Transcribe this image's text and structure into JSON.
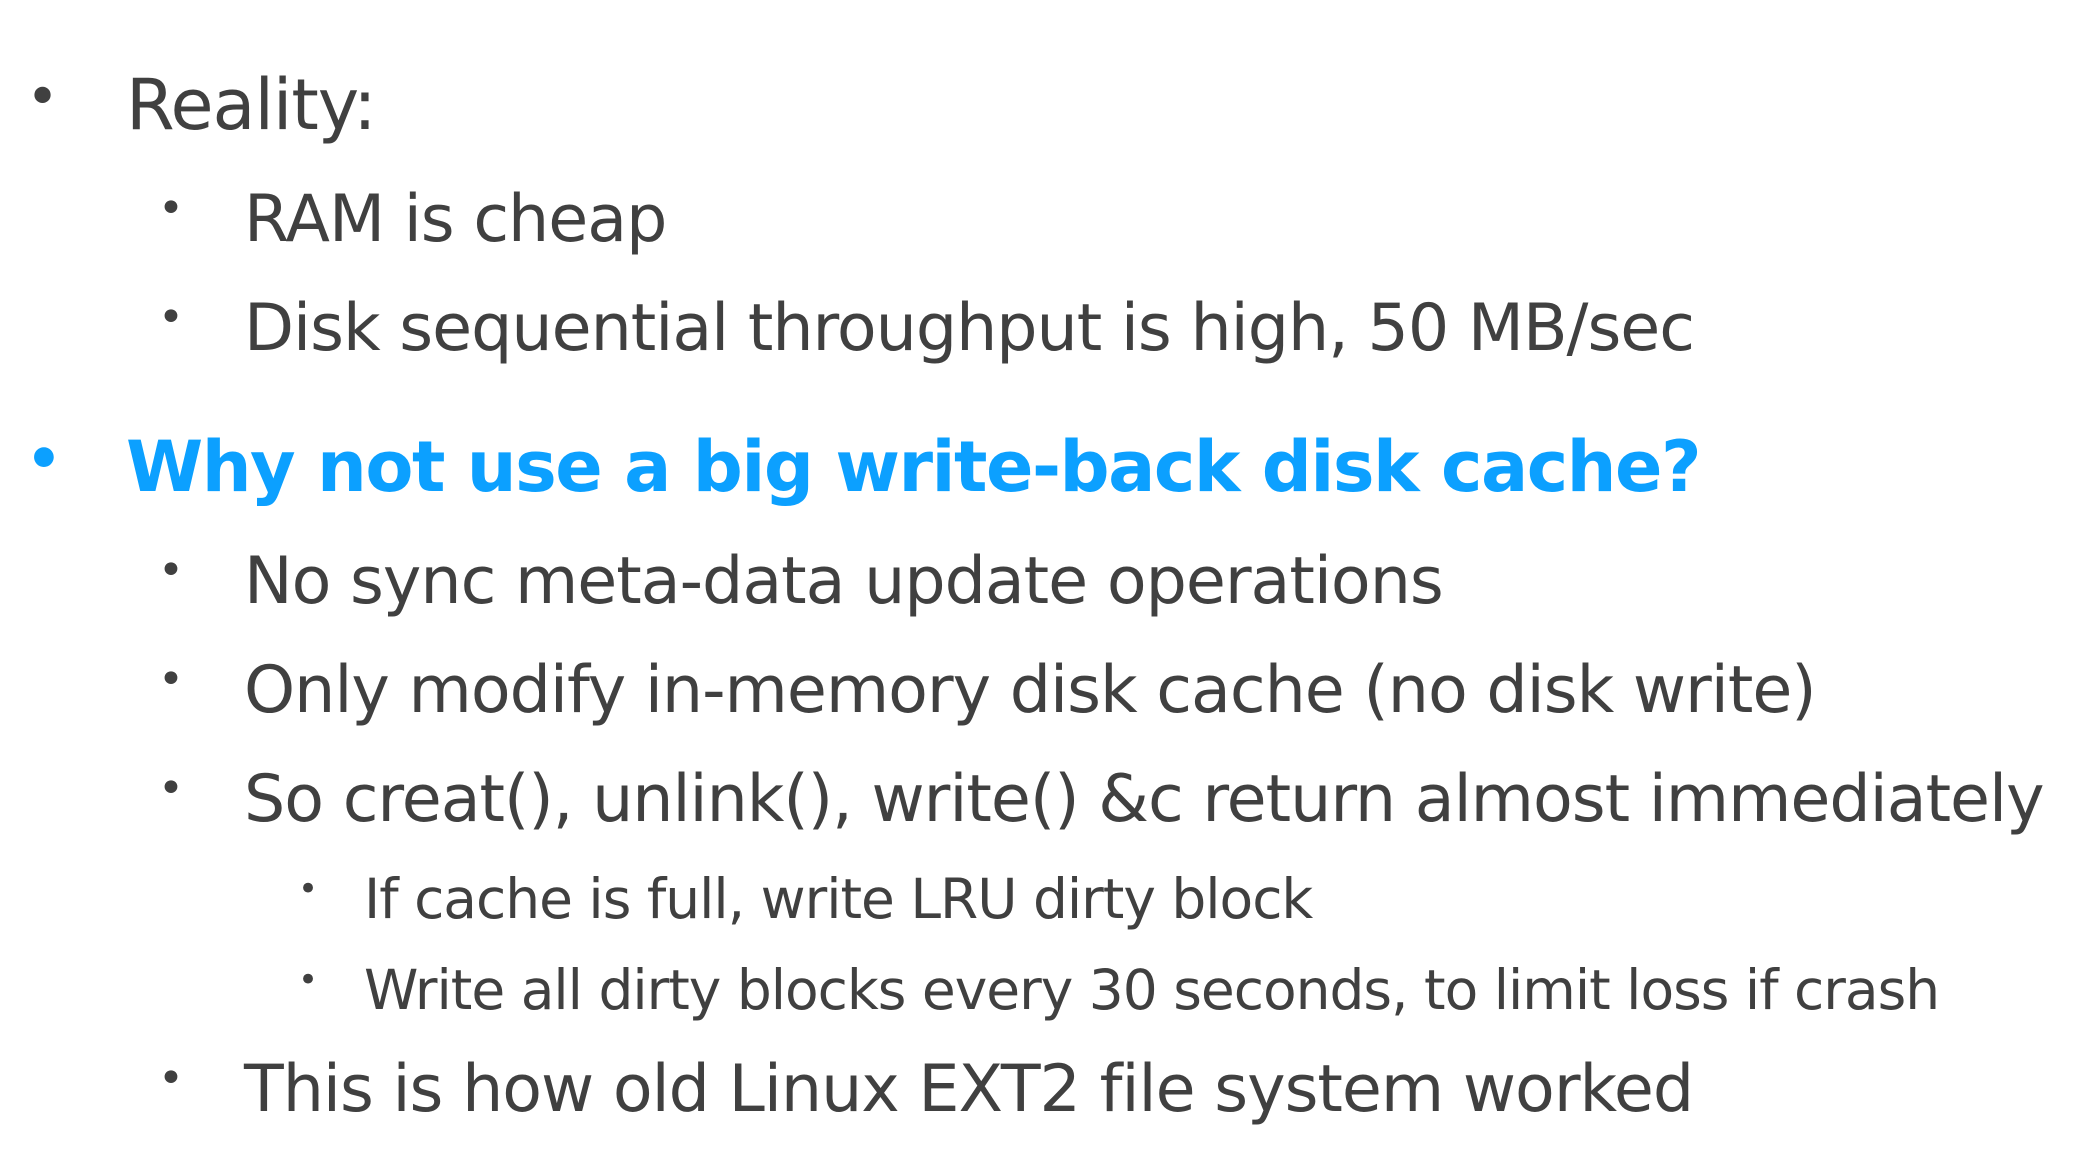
{
  "slide": {
    "items": [
      {
        "bullet": "•",
        "text": "Reality:"
      },
      {
        "bullet": "•",
        "text": "RAM is cheap"
      },
      {
        "bullet": "•",
        "text": "Disk sequential throughput is high, 50 MB/sec"
      },
      {
        "bullet": "•",
        "text": "Why not use a big write-back disk cache?"
      },
      {
        "bullet": "•",
        "text": "No sync meta-data update operations"
      },
      {
        "bullet": "•",
        "text": "Only modify in-memory disk cache (no disk write)"
      },
      {
        "bullet": "•",
        "text": "So creat(), unlink(), write() &c return almost immediately"
      },
      {
        "bullet": "•",
        "text": "If cache is full, write LRU dirty block"
      },
      {
        "bullet": "•",
        "text": "Write all dirty blocks every 30 seconds, to limit loss if crash"
      },
      {
        "bullet": "•",
        "text": "This is how old Linux EXT2 file system worked"
      }
    ]
  },
  "colors": {
    "text": "#404040",
    "accent": "#0ca0ff",
    "background": "#ffffff"
  }
}
